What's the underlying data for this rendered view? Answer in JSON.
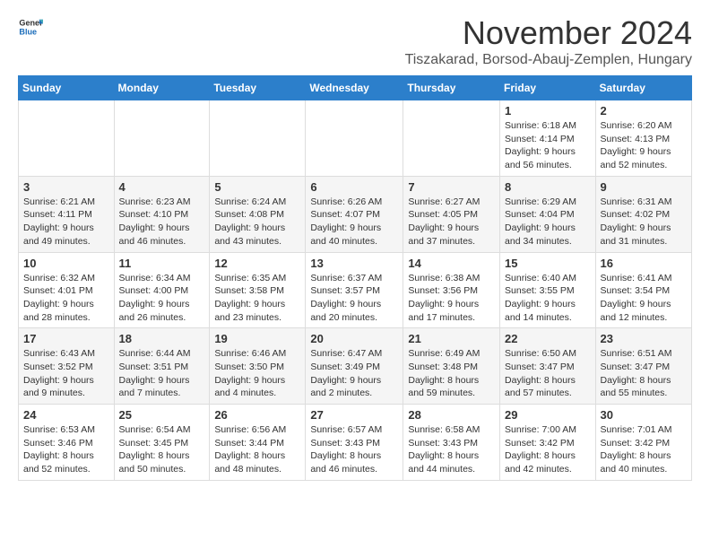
{
  "header": {
    "logo_general": "General",
    "logo_blue": "Blue",
    "title": "November 2024",
    "location": "Tiszakarad, Borsod-Abauj-Zemplen, Hungary"
  },
  "weekdays": [
    "Sunday",
    "Monday",
    "Tuesday",
    "Wednesday",
    "Thursday",
    "Friday",
    "Saturday"
  ],
  "weeks": [
    [
      {
        "day": "",
        "info": ""
      },
      {
        "day": "",
        "info": ""
      },
      {
        "day": "",
        "info": ""
      },
      {
        "day": "",
        "info": ""
      },
      {
        "day": "",
        "info": ""
      },
      {
        "day": "1",
        "info": "Sunrise: 6:18 AM\nSunset: 4:14 PM\nDaylight: 9 hours and 56 minutes."
      },
      {
        "day": "2",
        "info": "Sunrise: 6:20 AM\nSunset: 4:13 PM\nDaylight: 9 hours and 52 minutes."
      }
    ],
    [
      {
        "day": "3",
        "info": "Sunrise: 6:21 AM\nSunset: 4:11 PM\nDaylight: 9 hours and 49 minutes."
      },
      {
        "day": "4",
        "info": "Sunrise: 6:23 AM\nSunset: 4:10 PM\nDaylight: 9 hours and 46 minutes."
      },
      {
        "day": "5",
        "info": "Sunrise: 6:24 AM\nSunset: 4:08 PM\nDaylight: 9 hours and 43 minutes."
      },
      {
        "day": "6",
        "info": "Sunrise: 6:26 AM\nSunset: 4:07 PM\nDaylight: 9 hours and 40 minutes."
      },
      {
        "day": "7",
        "info": "Sunrise: 6:27 AM\nSunset: 4:05 PM\nDaylight: 9 hours and 37 minutes."
      },
      {
        "day": "8",
        "info": "Sunrise: 6:29 AM\nSunset: 4:04 PM\nDaylight: 9 hours and 34 minutes."
      },
      {
        "day": "9",
        "info": "Sunrise: 6:31 AM\nSunset: 4:02 PM\nDaylight: 9 hours and 31 minutes."
      }
    ],
    [
      {
        "day": "10",
        "info": "Sunrise: 6:32 AM\nSunset: 4:01 PM\nDaylight: 9 hours and 28 minutes."
      },
      {
        "day": "11",
        "info": "Sunrise: 6:34 AM\nSunset: 4:00 PM\nDaylight: 9 hours and 26 minutes."
      },
      {
        "day": "12",
        "info": "Sunrise: 6:35 AM\nSunset: 3:58 PM\nDaylight: 9 hours and 23 minutes."
      },
      {
        "day": "13",
        "info": "Sunrise: 6:37 AM\nSunset: 3:57 PM\nDaylight: 9 hours and 20 minutes."
      },
      {
        "day": "14",
        "info": "Sunrise: 6:38 AM\nSunset: 3:56 PM\nDaylight: 9 hours and 17 minutes."
      },
      {
        "day": "15",
        "info": "Sunrise: 6:40 AM\nSunset: 3:55 PM\nDaylight: 9 hours and 14 minutes."
      },
      {
        "day": "16",
        "info": "Sunrise: 6:41 AM\nSunset: 3:54 PM\nDaylight: 9 hours and 12 minutes."
      }
    ],
    [
      {
        "day": "17",
        "info": "Sunrise: 6:43 AM\nSunset: 3:52 PM\nDaylight: 9 hours and 9 minutes."
      },
      {
        "day": "18",
        "info": "Sunrise: 6:44 AM\nSunset: 3:51 PM\nDaylight: 9 hours and 7 minutes."
      },
      {
        "day": "19",
        "info": "Sunrise: 6:46 AM\nSunset: 3:50 PM\nDaylight: 9 hours and 4 minutes."
      },
      {
        "day": "20",
        "info": "Sunrise: 6:47 AM\nSunset: 3:49 PM\nDaylight: 9 hours and 2 minutes."
      },
      {
        "day": "21",
        "info": "Sunrise: 6:49 AM\nSunset: 3:48 PM\nDaylight: 8 hours and 59 minutes."
      },
      {
        "day": "22",
        "info": "Sunrise: 6:50 AM\nSunset: 3:47 PM\nDaylight: 8 hours and 57 minutes."
      },
      {
        "day": "23",
        "info": "Sunrise: 6:51 AM\nSunset: 3:47 PM\nDaylight: 8 hours and 55 minutes."
      }
    ],
    [
      {
        "day": "24",
        "info": "Sunrise: 6:53 AM\nSunset: 3:46 PM\nDaylight: 8 hours and 52 minutes."
      },
      {
        "day": "25",
        "info": "Sunrise: 6:54 AM\nSunset: 3:45 PM\nDaylight: 8 hours and 50 minutes."
      },
      {
        "day": "26",
        "info": "Sunrise: 6:56 AM\nSunset: 3:44 PM\nDaylight: 8 hours and 48 minutes."
      },
      {
        "day": "27",
        "info": "Sunrise: 6:57 AM\nSunset: 3:43 PM\nDaylight: 8 hours and 46 minutes."
      },
      {
        "day": "28",
        "info": "Sunrise: 6:58 AM\nSunset: 3:43 PM\nDaylight: 8 hours and 44 minutes."
      },
      {
        "day": "29",
        "info": "Sunrise: 7:00 AM\nSunset: 3:42 PM\nDaylight: 8 hours and 42 minutes."
      },
      {
        "day": "30",
        "info": "Sunrise: 7:01 AM\nSunset: 3:42 PM\nDaylight: 8 hours and 40 minutes."
      }
    ]
  ]
}
